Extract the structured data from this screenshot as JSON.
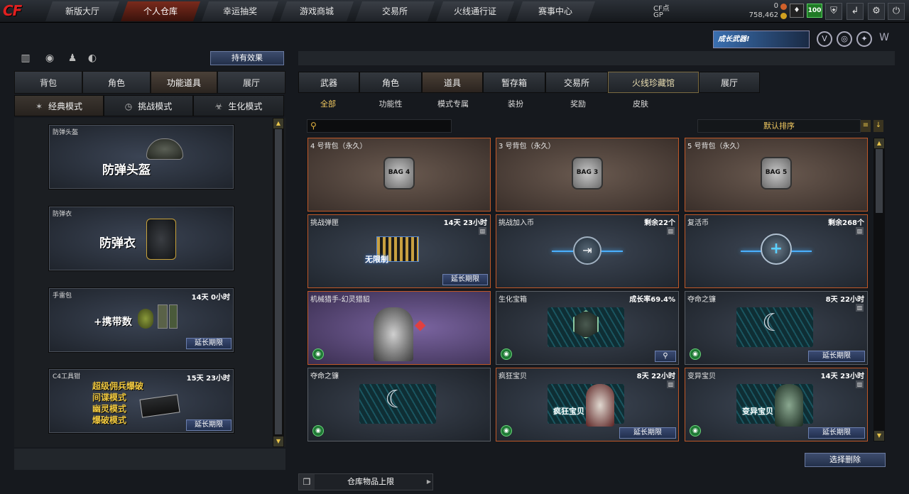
{
  "nav": {
    "tabs": [
      "新版大厅",
      "个人仓库",
      "幸运抽奖",
      "游戏商城",
      "交易所",
      "火线通行证",
      "赛事中心"
    ],
    "active": "个人仓库"
  },
  "currency": {
    "cf_label": "CF点",
    "cf_value": "0",
    "gp_label": "GP",
    "gp_value": "758,462"
  },
  "level_badge": "100",
  "banner_text": "成长武器!",
  "left": {
    "effect_button": "持有效果",
    "tabs": [
      "背包",
      "角色",
      "功能道具",
      "展厅"
    ],
    "active_tab": "功能道具",
    "modes": [
      "经典模式",
      "挑战模式",
      "生化模式"
    ],
    "items": [
      {
        "name": "防弹头盔",
        "title": "防弹头盔",
        "time": ""
      },
      {
        "name": "防弹衣",
        "title": "防弹衣",
        "time": ""
      },
      {
        "name": "手雷包",
        "title": "+携带数",
        "time": "14天 0小时",
        "extend": "延长期限"
      },
      {
        "name": "C4工具钳",
        "title": "超级佣兵爆破",
        "lines": [
          "间谍模式",
          "幽灵模式",
          "爆破模式"
        ],
        "time": "15天 23小时",
        "extend": "延长期限"
      }
    ]
  },
  "right": {
    "tabs": [
      "武器",
      "角色",
      "道具",
      "暂存箱",
      "交易所",
      "火线珍藏馆",
      "展厅"
    ],
    "active_tab": "道具",
    "subtabs": [
      "全部",
      "功能性",
      "模式专属",
      "装扮",
      "奖励",
      "皮肤"
    ],
    "active_subtab": "全部",
    "search_placeholder": "",
    "sort_label": "默认排序",
    "cards": [
      {
        "name": "4 号背包（永久）",
        "time": "",
        "icon": "BAG 4"
      },
      {
        "name": "3 号背包（永久）",
        "time": "",
        "icon": "BAG 3"
      },
      {
        "name": "5 号背包（永久）",
        "time": "",
        "icon": "BAG 5"
      },
      {
        "name": "挑战弹匣",
        "time": "14天 23小时",
        "extend": "延长期限",
        "caption": "无限制"
      },
      {
        "name": "挑战加入币",
        "time": "剩余22个"
      },
      {
        "name": "复活币",
        "time": "剩余268个"
      },
      {
        "name": "机械猎手-幻灵猎貂",
        "time": ""
      },
      {
        "name": "生化宝箱",
        "time": "成长率69.4%"
      },
      {
        "name": "夺命之镰",
        "time": "8天 22小时",
        "extend": "延长期限"
      },
      {
        "name": "夺命之镰",
        "time": ""
      },
      {
        "name": "疯狂宝贝",
        "time": "8天 22小时",
        "extend": "延长期限",
        "caption": "疯狂宝贝"
      },
      {
        "name": "变异宝贝",
        "time": "14天 23小时",
        "extend": "延长期限",
        "caption": "变异宝贝"
      }
    ],
    "select_delete": "选择删除",
    "capacity": "仓库物品上限"
  }
}
